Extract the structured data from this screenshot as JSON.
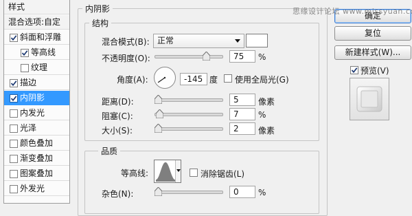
{
  "styles_panel": {
    "items": [
      {
        "label": "样式",
        "checkbox": false,
        "checked": false,
        "selected": false,
        "indent": false
      },
      {
        "label": "混合选项:自定",
        "checkbox": false,
        "checked": false,
        "selected": false,
        "indent": false
      },
      {
        "label": "斜面和浮雕",
        "checkbox": true,
        "checked": true,
        "selected": false,
        "indent": false
      },
      {
        "label": "等高线",
        "checkbox": true,
        "checked": true,
        "selected": false,
        "indent": true
      },
      {
        "label": "纹理",
        "checkbox": true,
        "checked": false,
        "selected": false,
        "indent": true
      },
      {
        "label": "描边",
        "checkbox": true,
        "checked": true,
        "selected": false,
        "indent": false
      },
      {
        "label": "内阴影",
        "checkbox": true,
        "checked": true,
        "selected": true,
        "indent": false
      },
      {
        "label": "内发光",
        "checkbox": true,
        "checked": false,
        "selected": false,
        "indent": false
      },
      {
        "label": "光泽",
        "checkbox": true,
        "checked": false,
        "selected": false,
        "indent": false
      },
      {
        "label": "颜色叠加",
        "checkbox": true,
        "checked": false,
        "selected": false,
        "indent": false
      },
      {
        "label": "渐变叠加",
        "checkbox": true,
        "checked": false,
        "selected": false,
        "indent": false
      },
      {
        "label": "图案叠加",
        "checkbox": true,
        "checked": false,
        "selected": false,
        "indent": false
      },
      {
        "label": "外发光",
        "checkbox": true,
        "checked": false,
        "selected": false,
        "indent": false
      }
    ]
  },
  "inner_shadow": {
    "title": "内阴影",
    "structure": {
      "title": "结构",
      "blend_mode_label": "混合模式(B):",
      "blend_mode_value": "正常",
      "color_swatch": "#ffffff",
      "opacity_label": "不透明度(O):",
      "opacity_value": "75",
      "opacity_unit": "%",
      "opacity_level": 0.75,
      "angle_label": "角度(A):",
      "angle_value": "-145",
      "angle_unit": "度",
      "angle_degrees": -145,
      "global_light_label": "使用全局光(G)",
      "global_light_checked": false,
      "distance_label": "距离(D):",
      "distance_value": "5",
      "distance_unit": "像素",
      "choke_label": "阻塞(C):",
      "choke_value": "7",
      "choke_unit": "%",
      "size_label": "大小(S):",
      "size_value": "2",
      "size_unit": "像素"
    },
    "quality": {
      "title": "品质",
      "contour_label": "等高线:",
      "anti_alias_label": "消除锯齿(L)",
      "anti_alias_checked": false,
      "noise_label": "杂色(N):",
      "noise_value": "0",
      "noise_unit": "%"
    }
  },
  "buttons": {
    "ok": "确定",
    "reset": "复位",
    "new_style": "新建样式(W)...",
    "preview_label": "预览(V)",
    "preview_checked": true
  },
  "watermark": "思缘设计论坛 www.missyuan.com"
}
